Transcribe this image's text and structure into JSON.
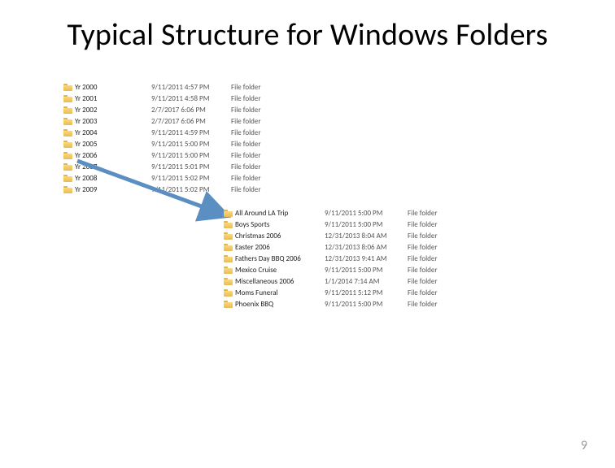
{
  "title": "Typical Structure for Windows Folders",
  "page_number": "9",
  "arrow": {
    "color": "#5b8fc1"
  },
  "list1": [
    {
      "name": "Yr 2000",
      "date": "9/11/2011 4:57 PM",
      "type": "File folder"
    },
    {
      "name": "Yr 2001",
      "date": "9/11/2011 4:58 PM",
      "type": "File folder"
    },
    {
      "name": "Yr 2002",
      "date": "2/7/2017 6:06 PM",
      "type": "File folder"
    },
    {
      "name": "Yr 2003",
      "date": "2/7/2017 6:06 PM",
      "type": "File folder"
    },
    {
      "name": "Yr 2004",
      "date": "9/11/2011 4:59 PM",
      "type": "File folder"
    },
    {
      "name": "Yr 2005",
      "date": "9/11/2011 5:00 PM",
      "type": "File folder"
    },
    {
      "name": "Yr 2006",
      "date": "9/11/2011 5:00 PM",
      "type": "File folder"
    },
    {
      "name": "Yr 2007",
      "date": "9/11/2011 5:01 PM",
      "type": "File folder"
    },
    {
      "name": "Yr 2008",
      "date": "9/11/2011 5:02 PM",
      "type": "File folder"
    },
    {
      "name": "Yr 2009",
      "date": "9/11/2011 5:02 PM",
      "type": "File folder"
    }
  ],
  "list2": [
    {
      "name": "All Around LA Trip",
      "date": "9/11/2011 5:00 PM",
      "type": "File folder"
    },
    {
      "name": "Boys Sports",
      "date": "9/11/2011 5:00 PM",
      "type": "File folder"
    },
    {
      "name": "Christmas 2006",
      "date": "12/31/2013 8:04 AM",
      "type": "File folder"
    },
    {
      "name": "Easter 2006",
      "date": "12/31/2013 8:06 AM",
      "type": "File folder"
    },
    {
      "name": "Fathers Day BBQ 2006",
      "date": "12/31/2013 9:41 AM",
      "type": "File folder"
    },
    {
      "name": "Mexico Cruise",
      "date": "9/11/2011 5:00 PM",
      "type": "File folder"
    },
    {
      "name": "Miscellaneous 2006",
      "date": "1/1/2014 7:14 AM",
      "type": "File folder"
    },
    {
      "name": "Moms Funeral",
      "date": "9/11/2011 5:12 PM",
      "type": "File folder"
    },
    {
      "name": "Phoenix BBQ",
      "date": "9/11/2011 5:00 PM",
      "type": "File folder"
    }
  ]
}
